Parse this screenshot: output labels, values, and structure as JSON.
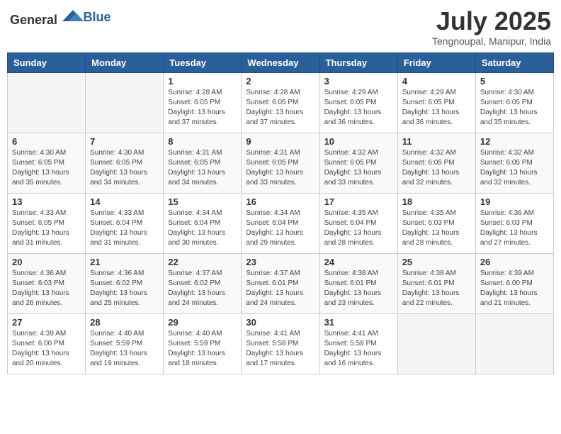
{
  "header": {
    "logo_general": "General",
    "logo_blue": "Blue",
    "title": "July 2025",
    "location": "Tengnoupal, Manipur, India"
  },
  "days_of_week": [
    "Sunday",
    "Monday",
    "Tuesday",
    "Wednesday",
    "Thursday",
    "Friday",
    "Saturday"
  ],
  "weeks": [
    [
      {
        "day": "",
        "info": ""
      },
      {
        "day": "",
        "info": ""
      },
      {
        "day": "1",
        "sunrise": "4:28 AM",
        "sunset": "6:05 PM",
        "daylight": "13 hours and 37 minutes."
      },
      {
        "day": "2",
        "sunrise": "4:28 AM",
        "sunset": "6:05 PM",
        "daylight": "13 hours and 37 minutes."
      },
      {
        "day": "3",
        "sunrise": "4:29 AM",
        "sunset": "6:05 PM",
        "daylight": "13 hours and 36 minutes."
      },
      {
        "day": "4",
        "sunrise": "4:29 AM",
        "sunset": "6:05 PM",
        "daylight": "13 hours and 36 minutes."
      },
      {
        "day": "5",
        "sunrise": "4:30 AM",
        "sunset": "6:05 PM",
        "daylight": "13 hours and 35 minutes."
      }
    ],
    [
      {
        "day": "6",
        "sunrise": "4:30 AM",
        "sunset": "6:05 PM",
        "daylight": "13 hours and 35 minutes."
      },
      {
        "day": "7",
        "sunrise": "4:30 AM",
        "sunset": "6:05 PM",
        "daylight": "13 hours and 34 minutes."
      },
      {
        "day": "8",
        "sunrise": "4:31 AM",
        "sunset": "6:05 PM",
        "daylight": "13 hours and 34 minutes."
      },
      {
        "day": "9",
        "sunrise": "4:31 AM",
        "sunset": "6:05 PM",
        "daylight": "13 hours and 33 minutes."
      },
      {
        "day": "10",
        "sunrise": "4:32 AM",
        "sunset": "6:05 PM",
        "daylight": "13 hours and 33 minutes."
      },
      {
        "day": "11",
        "sunrise": "4:32 AM",
        "sunset": "6:05 PM",
        "daylight": "13 hours and 32 minutes."
      },
      {
        "day": "12",
        "sunrise": "4:32 AM",
        "sunset": "6:05 PM",
        "daylight": "13 hours and 32 minutes."
      }
    ],
    [
      {
        "day": "13",
        "sunrise": "4:33 AM",
        "sunset": "6:05 PM",
        "daylight": "13 hours and 31 minutes."
      },
      {
        "day": "14",
        "sunrise": "4:33 AM",
        "sunset": "6:04 PM",
        "daylight": "13 hours and 31 minutes."
      },
      {
        "day": "15",
        "sunrise": "4:34 AM",
        "sunset": "6:04 PM",
        "daylight": "13 hours and 30 minutes."
      },
      {
        "day": "16",
        "sunrise": "4:34 AM",
        "sunset": "6:04 PM",
        "daylight": "13 hours and 29 minutes."
      },
      {
        "day": "17",
        "sunrise": "4:35 AM",
        "sunset": "6:04 PM",
        "daylight": "13 hours and 28 minutes."
      },
      {
        "day": "18",
        "sunrise": "4:35 AM",
        "sunset": "6:03 PM",
        "daylight": "13 hours and 28 minutes."
      },
      {
        "day": "19",
        "sunrise": "4:36 AM",
        "sunset": "6:03 PM",
        "daylight": "13 hours and 27 minutes."
      }
    ],
    [
      {
        "day": "20",
        "sunrise": "4:36 AM",
        "sunset": "6:03 PM",
        "daylight": "13 hours and 26 minutes."
      },
      {
        "day": "21",
        "sunrise": "4:36 AM",
        "sunset": "6:02 PM",
        "daylight": "13 hours and 25 minutes."
      },
      {
        "day": "22",
        "sunrise": "4:37 AM",
        "sunset": "6:02 PM",
        "daylight": "13 hours and 24 minutes."
      },
      {
        "day": "23",
        "sunrise": "4:37 AM",
        "sunset": "6:01 PM",
        "daylight": "13 hours and 24 minutes."
      },
      {
        "day": "24",
        "sunrise": "4:38 AM",
        "sunset": "6:01 PM",
        "daylight": "13 hours and 23 minutes."
      },
      {
        "day": "25",
        "sunrise": "4:38 AM",
        "sunset": "6:01 PM",
        "daylight": "13 hours and 22 minutes."
      },
      {
        "day": "26",
        "sunrise": "4:39 AM",
        "sunset": "6:00 PM",
        "daylight": "13 hours and 21 minutes."
      }
    ],
    [
      {
        "day": "27",
        "sunrise": "4:39 AM",
        "sunset": "6:00 PM",
        "daylight": "13 hours and 20 minutes."
      },
      {
        "day": "28",
        "sunrise": "4:40 AM",
        "sunset": "5:59 PM",
        "daylight": "13 hours and 19 minutes."
      },
      {
        "day": "29",
        "sunrise": "4:40 AM",
        "sunset": "5:59 PM",
        "daylight": "13 hours and 18 minutes."
      },
      {
        "day": "30",
        "sunrise": "4:41 AM",
        "sunset": "5:58 PM",
        "daylight": "13 hours and 17 minutes."
      },
      {
        "day": "31",
        "sunrise": "4:41 AM",
        "sunset": "5:58 PM",
        "daylight": "13 hours and 16 minutes."
      },
      {
        "day": "",
        "info": ""
      },
      {
        "day": "",
        "info": ""
      }
    ]
  ],
  "labels": {
    "sunrise": "Sunrise:",
    "sunset": "Sunset:",
    "daylight": "Daylight:"
  }
}
